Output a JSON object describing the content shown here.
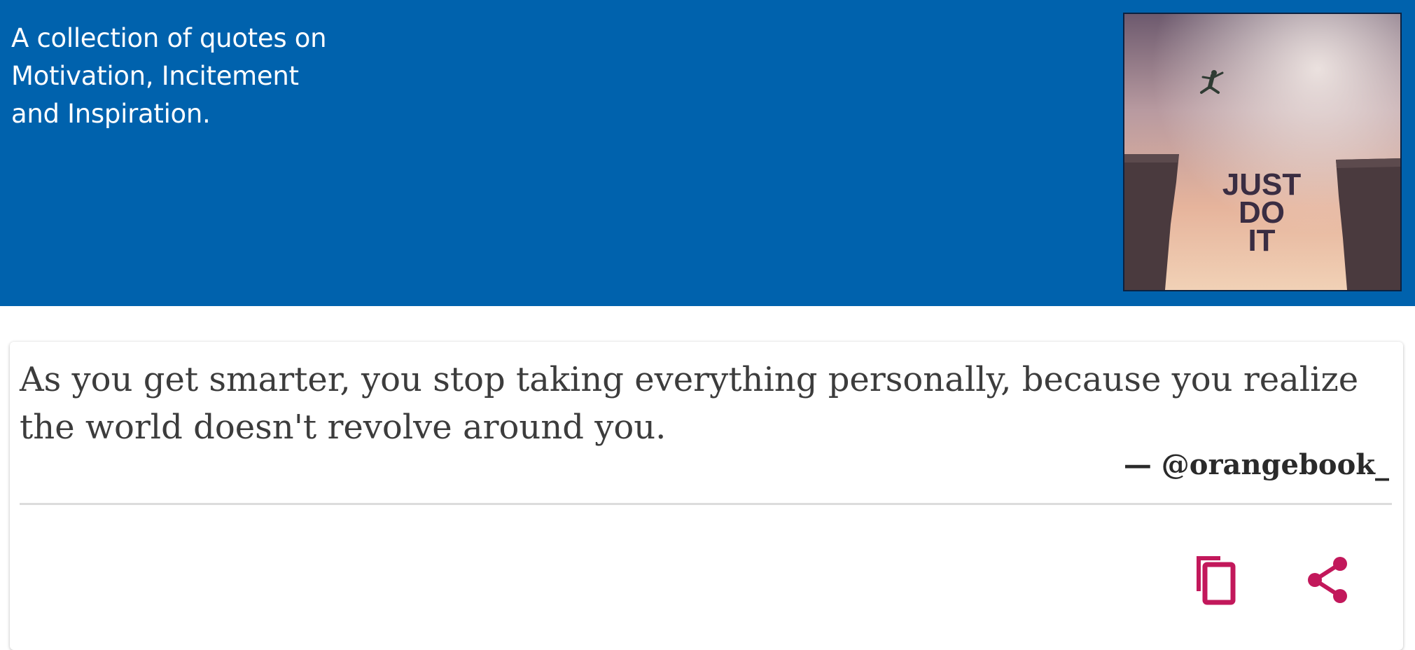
{
  "header": {
    "tagline_lines": [
      "A collection of quotes on",
      "Motivation, Incitement",
      "and Inspiration."
    ],
    "background_color": "#0062ad",
    "cover_image": {
      "icon": "just-do-it-cover-image",
      "text_lines": [
        "JUST",
        "DO",
        "IT"
      ]
    }
  },
  "quote_card": {
    "quote_text": "As you get smarter, you stop taking everything personally, because you realize the world doesn't revolve around you.",
    "author": "— @orangebook_",
    "actions": [
      {
        "name": "copy",
        "icon": "copy-icon"
      },
      {
        "name": "share",
        "icon": "share-icon"
      }
    ],
    "accent_color": "#c2185b"
  }
}
